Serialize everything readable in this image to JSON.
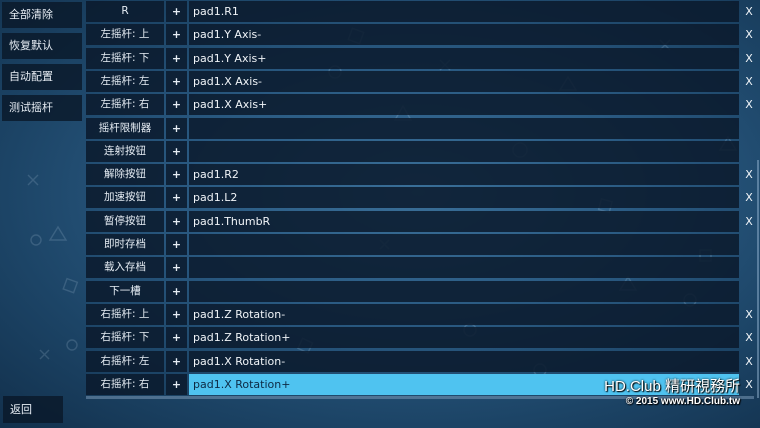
{
  "sidebar": {
    "items": [
      {
        "label": "全部清除"
      },
      {
        "label": "恢复默认"
      },
      {
        "label": "自动配置"
      },
      {
        "label": "测试摇杆"
      }
    ],
    "back_label": "返回"
  },
  "mappings": [
    {
      "label": "R",
      "plus": "+",
      "value": "pad1.R1",
      "clear": "X"
    },
    {
      "label": "左摇杆: 上",
      "plus": "+",
      "value": "pad1.Y Axis-",
      "clear": "X"
    },
    {
      "label": "左摇杆: 下",
      "plus": "+",
      "value": "pad1.Y Axis+",
      "clear": "X"
    },
    {
      "label": "左摇杆: 左",
      "plus": "+",
      "value": "pad1.X Axis-",
      "clear": "X"
    },
    {
      "label": "左摇杆: 右",
      "plus": "+",
      "value": "pad1.X Axis+",
      "clear": "X"
    },
    {
      "label": "摇杆限制器",
      "plus": "+",
      "value": "",
      "clear": ""
    },
    {
      "label": "连射按钮",
      "plus": "+",
      "value": "",
      "clear": ""
    },
    {
      "label": "解除按钮",
      "plus": "+",
      "value": "pad1.R2",
      "clear": "X"
    },
    {
      "label": "加速按钮",
      "plus": "+",
      "value": "pad1.L2",
      "clear": "X"
    },
    {
      "label": "暂停按钮",
      "plus": "+",
      "value": "pad1.ThumbR",
      "clear": "X"
    },
    {
      "label": "即时存档",
      "plus": "+",
      "value": "",
      "clear": ""
    },
    {
      "label": "载入存档",
      "plus": "+",
      "value": "",
      "clear": ""
    },
    {
      "label": "下一槽",
      "plus": "+",
      "value": "",
      "clear": ""
    },
    {
      "label": "右摇杆: 上",
      "plus": "+",
      "value": "pad1.Z Rotation-",
      "clear": "X"
    },
    {
      "label": "右摇杆: 下",
      "plus": "+",
      "value": "pad1.Z Rotation+",
      "clear": "X"
    },
    {
      "label": "右摇杆: 左",
      "plus": "+",
      "value": "pad1.X Rotation-",
      "clear": "X"
    },
    {
      "label": "右摇杆: 右",
      "plus": "+",
      "value": "pad1.X Rotation+",
      "clear": "X",
      "selected": true
    }
  ],
  "watermark": {
    "line1": "HD.Club 精研視務所",
    "line2": "© 2015  www.HD.Club.tw"
  },
  "colors": {
    "background": "#2a5a82",
    "cell": "#0a1a2c",
    "selected": "#4fc3f0"
  }
}
